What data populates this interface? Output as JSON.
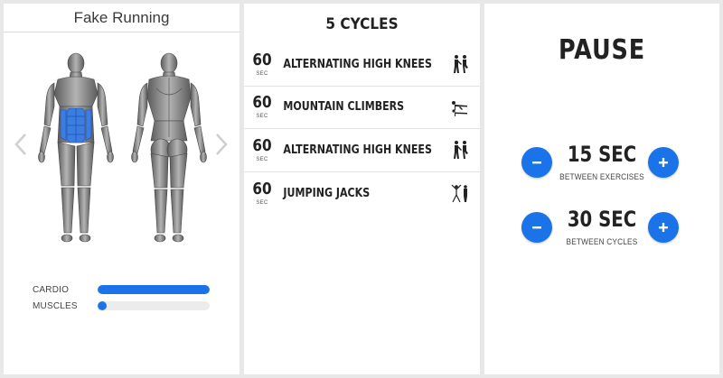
{
  "workout": {
    "title": "Fake Running",
    "stats": [
      {
        "label": "CARDIO",
        "level": 1.0
      },
      {
        "label": "MUSCLES",
        "level": 0.08
      }
    ],
    "colors": {
      "accent": "#1a73e8",
      "muscle_highlight": "#3b7de0",
      "muscle_base": "#8a8a8a"
    },
    "icons": {
      "prev": "chevron-left-icon",
      "next": "chevron-right-icon"
    }
  },
  "exercises": {
    "title": "5 CYCLES",
    "items": [
      {
        "duration": "60",
        "unit": "SEC",
        "name": "ALTERNATING HIGH KNEES",
        "icon": "high-knees-icon"
      },
      {
        "duration": "60",
        "unit": "SEC",
        "name": "MOUNTAIN CLIMBERS",
        "icon": "mountain-climbers-icon"
      },
      {
        "duration": "60",
        "unit": "SEC",
        "name": "ALTERNATING HIGH KNEES",
        "icon": "high-knees-icon"
      },
      {
        "duration": "60",
        "unit": "SEC",
        "name": "JUMPING JACKS",
        "icon": "jumping-jacks-icon"
      }
    ]
  },
  "pause": {
    "title": "PAUSE",
    "between_exercises": {
      "value": "15 SEC",
      "label": "BETWEEN EXERCISES"
    },
    "between_cycles": {
      "value": "30 SEC",
      "label": "BETWEEN CYCLES"
    }
  }
}
